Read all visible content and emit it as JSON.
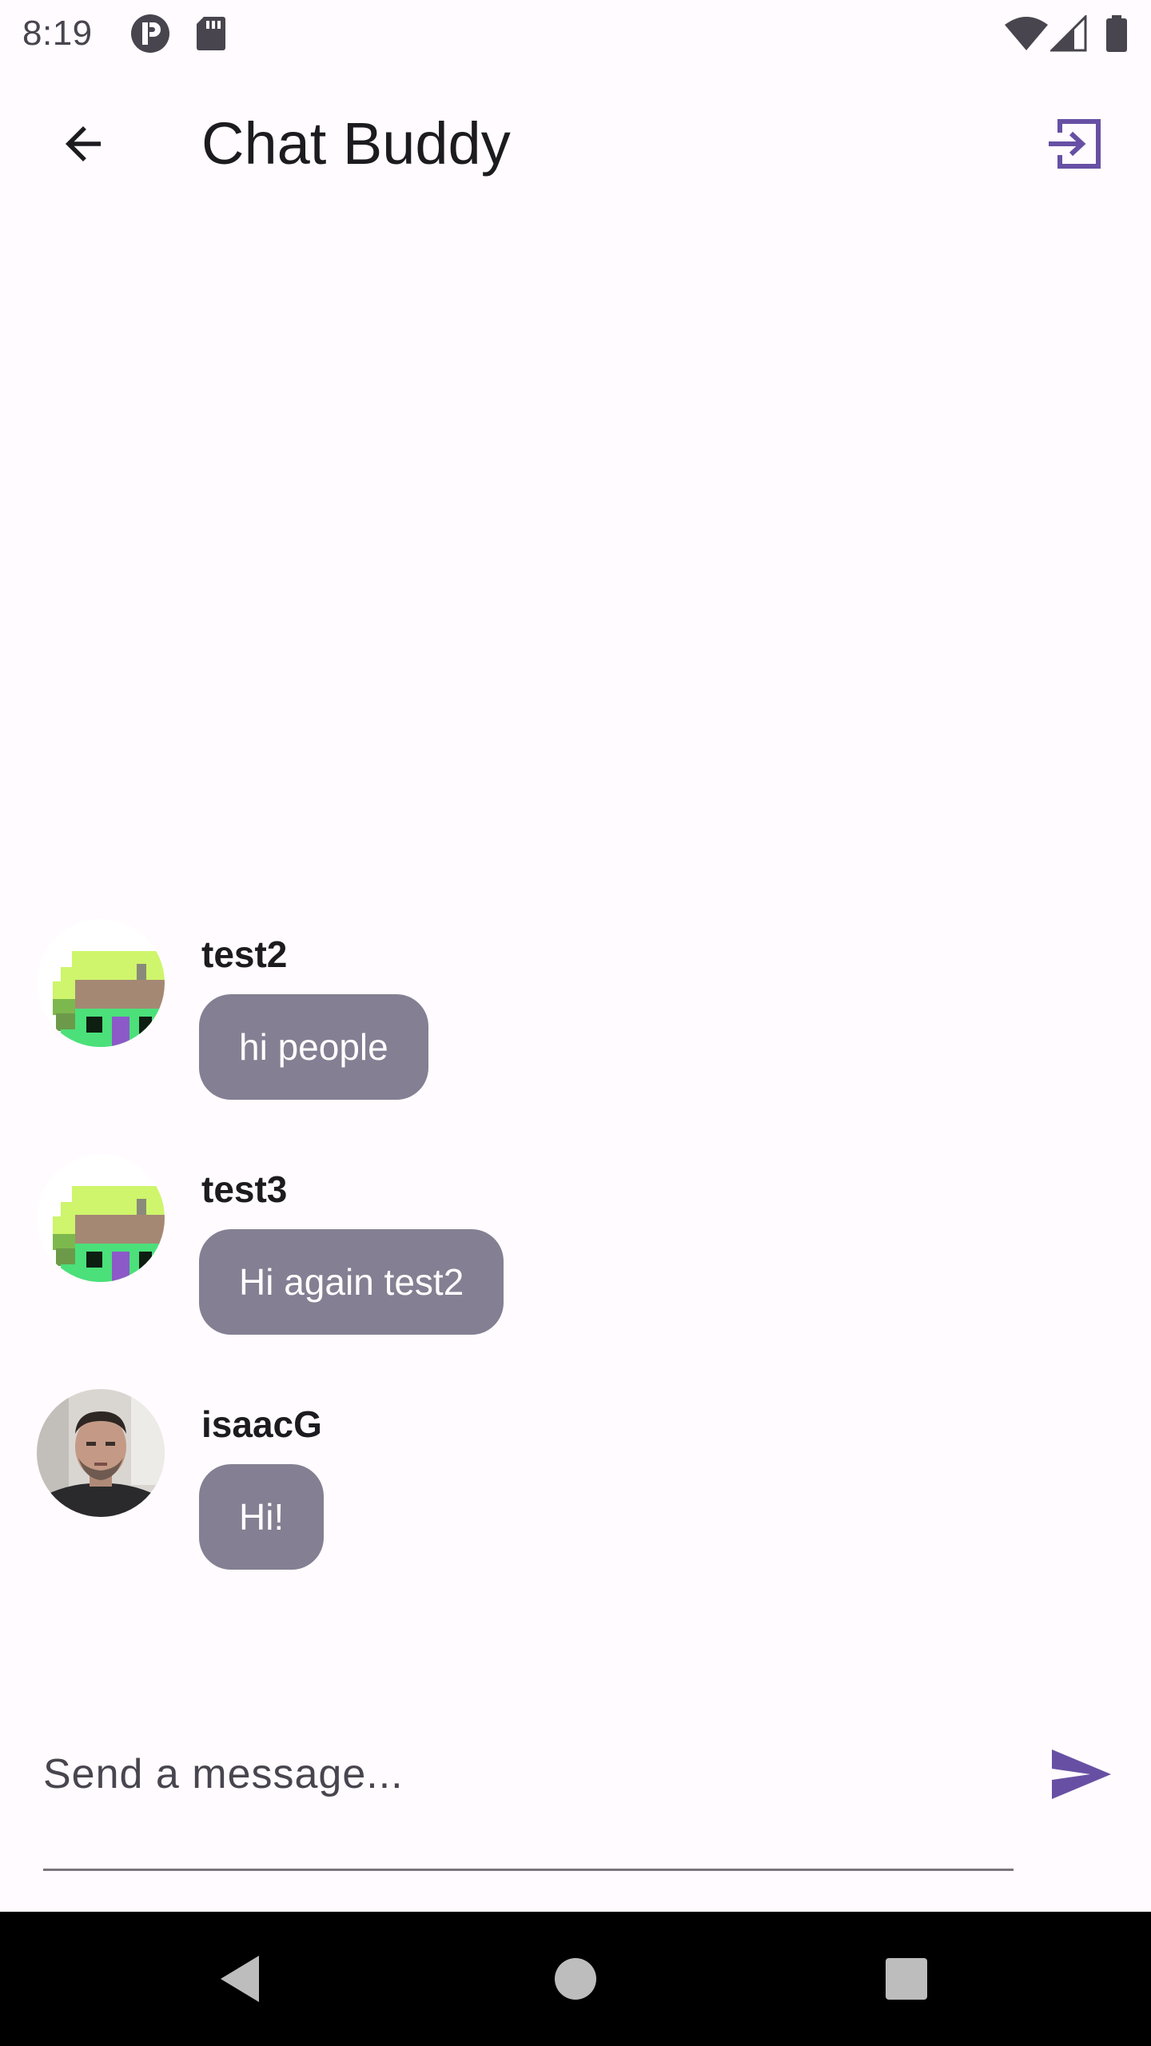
{
  "status_bar": {
    "time": "8:19",
    "icons": [
      "app-badge-icon",
      "sd-card-icon",
      "wifi-icon",
      "cell-signal-icon",
      "battery-icon"
    ]
  },
  "app_bar": {
    "title": "Chat Buddy",
    "back_icon": "arrow-back-icon",
    "action_icon": "logout-icon"
  },
  "messages": [
    {
      "sender": "test2",
      "text": "hi people",
      "avatar": "pixel-art-avatar"
    },
    {
      "sender": "test3",
      "text": "Hi again test2",
      "avatar": "pixel-art-avatar"
    },
    {
      "sender": "isaacG",
      "text": "Hi!",
      "avatar": "photo-avatar"
    }
  ],
  "composer": {
    "placeholder": "Send a message...",
    "value": "",
    "send_icon": "send-icon"
  },
  "nav_bar": {
    "icons": [
      "back-triangle-icon",
      "home-circle-icon",
      "recents-square-icon"
    ]
  },
  "colors": {
    "background": "#FFFBFE",
    "accent": "#6750A4",
    "bubble": "#847F92",
    "bubble_text": "#FFFFFF"
  }
}
